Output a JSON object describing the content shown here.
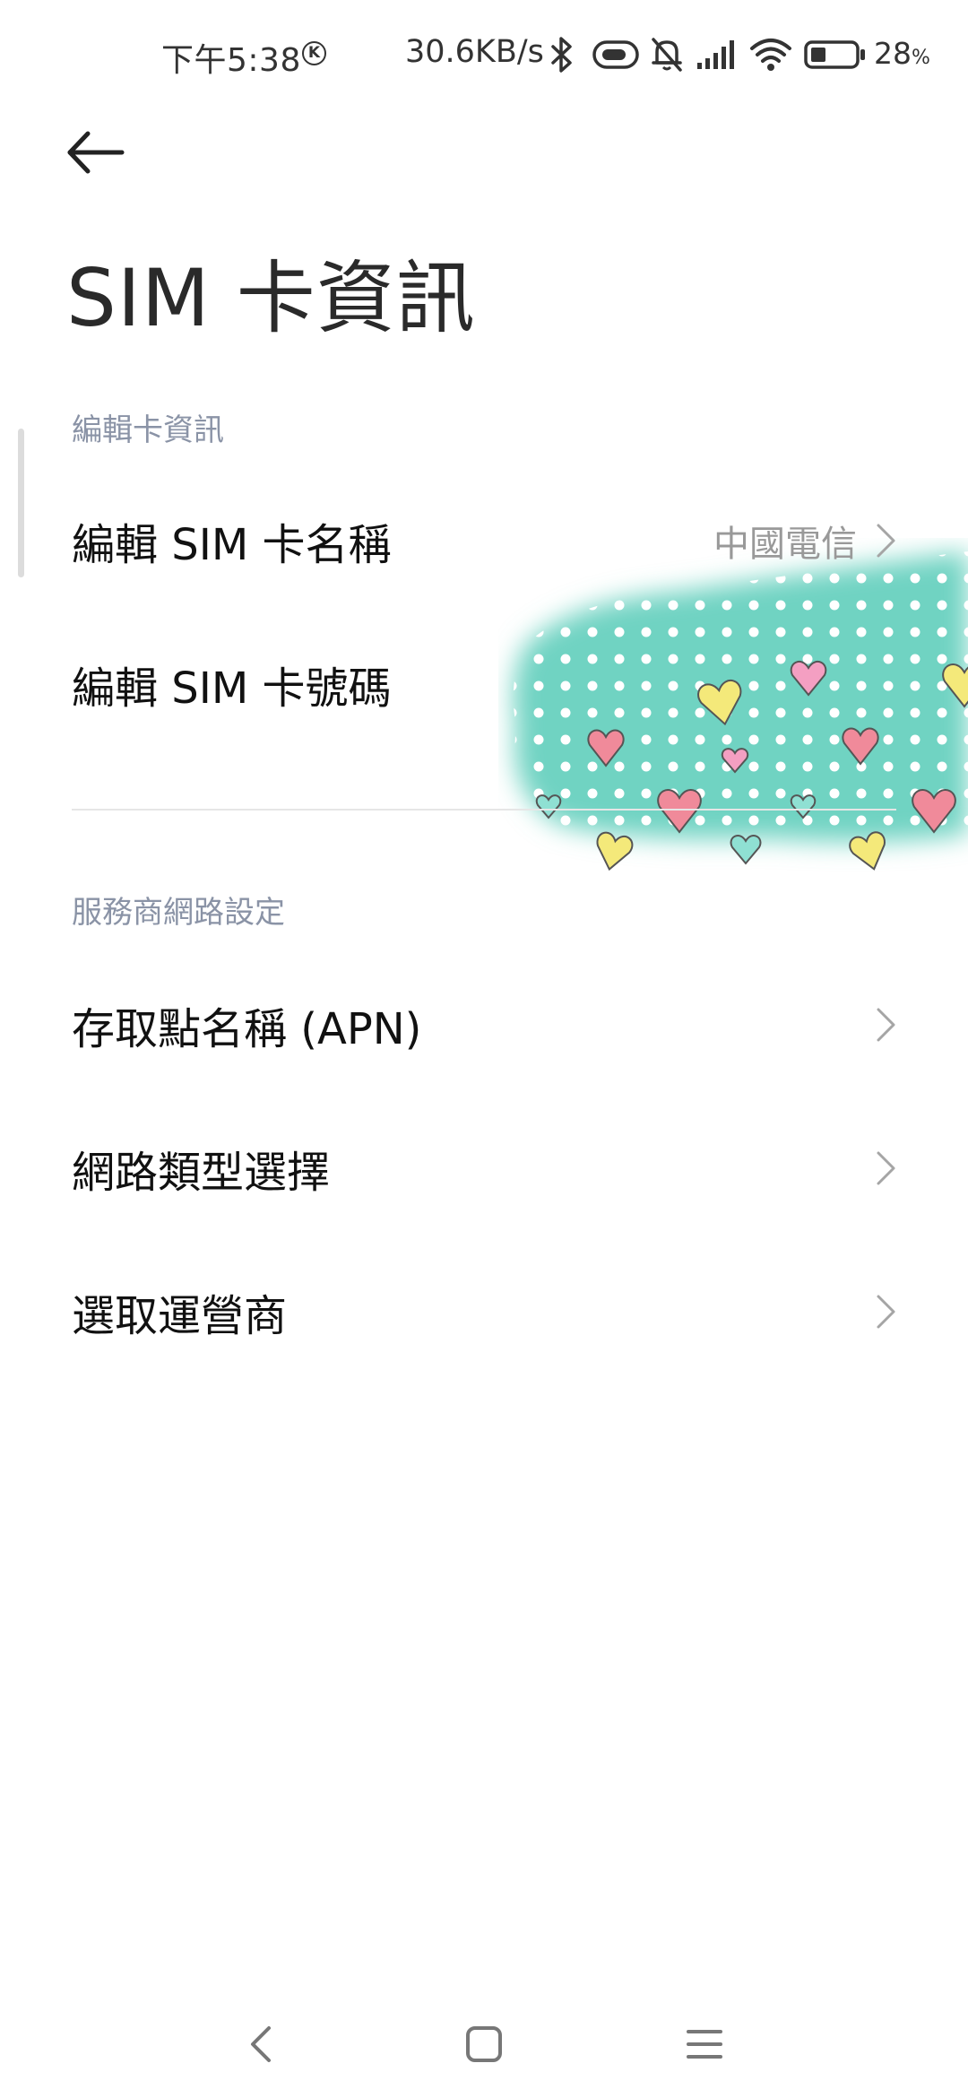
{
  "status_bar": {
    "time": "下午5:38",
    "k_badge": "K",
    "speed": "30.6KB/s",
    "battery": "28",
    "battery_unit": "%",
    "icons": [
      "bluetooth-icon",
      "nfc-icon",
      "mute-bell-icon",
      "signal-icon",
      "wifi-icon",
      "battery-icon"
    ]
  },
  "header": {
    "back_icon": "back-arrow-icon",
    "title": "SIM 卡資訊"
  },
  "sections": [
    {
      "header": "編輯卡資訊",
      "items": [
        {
          "label": "編輯 SIM 卡名稱",
          "value": "中國電信",
          "chevron": true
        },
        {
          "label": "編輯 SIM 卡號碼",
          "value": "",
          "chevron": false
        }
      ]
    },
    {
      "header": "服務商網路設定",
      "items": [
        {
          "label": "存取點名稱 (APN)",
          "value": "",
          "chevron": true
        },
        {
          "label": "網路類型選擇",
          "value": "",
          "chevron": true
        },
        {
          "label": "選取運營商",
          "value": "",
          "chevron": true
        }
      ]
    }
  ],
  "nav_bar": {
    "icons": [
      "nav-back-icon",
      "nav-home-icon",
      "nav-recents-icon"
    ]
  },
  "colors": {
    "section_header": "#8a93a6",
    "value_text": "#999999",
    "decor_teal": "#5fcfbb"
  }
}
